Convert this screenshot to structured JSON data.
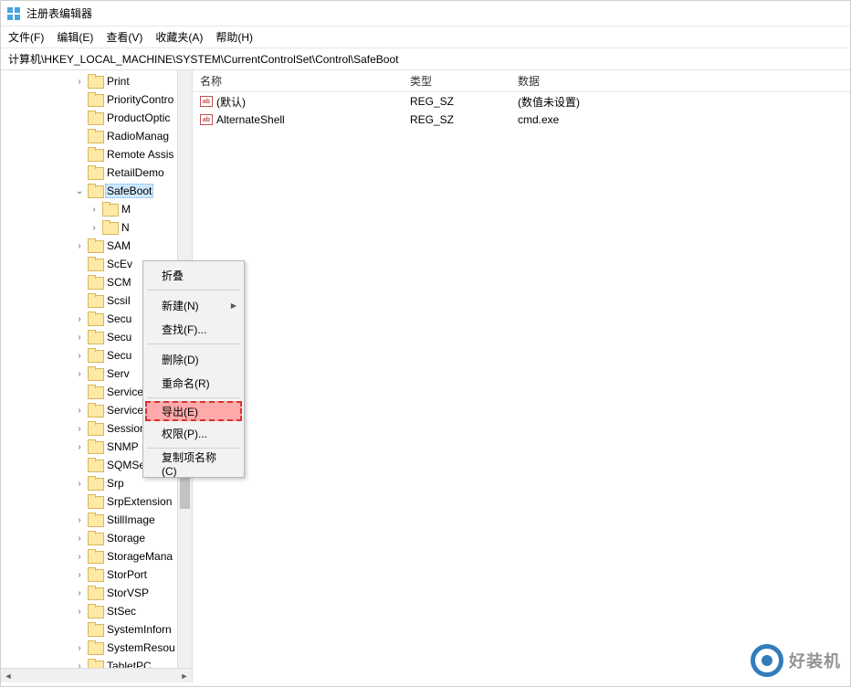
{
  "window": {
    "title": "注册表编辑器"
  },
  "menubar": [
    "文件(F)",
    "编辑(E)",
    "查看(V)",
    "收藏夹(A)",
    "帮助(H)"
  ],
  "address": "计算机\\HKEY_LOCAL_MACHINE\\SYSTEM\\CurrentControlSet\\Control\\SafeBoot",
  "tree": [
    {
      "indent": 5,
      "exp": ">",
      "label": "Print"
    },
    {
      "indent": 5,
      "exp": "",
      "label": "PriorityContro"
    },
    {
      "indent": 5,
      "exp": "",
      "label": "ProductOptic"
    },
    {
      "indent": 5,
      "exp": "",
      "label": "RadioManag"
    },
    {
      "indent": 5,
      "exp": "",
      "label": "Remote Assis"
    },
    {
      "indent": 5,
      "exp": "",
      "label": "RetailDemo"
    },
    {
      "indent": 5,
      "exp": "v",
      "label": "SafeBoot",
      "selected": true
    },
    {
      "indent": 6,
      "exp": ">",
      "label": "M"
    },
    {
      "indent": 6,
      "exp": ">",
      "label": "N"
    },
    {
      "indent": 5,
      "exp": ">",
      "label": "SAM"
    },
    {
      "indent": 5,
      "exp": "",
      "label": "ScEv"
    },
    {
      "indent": 5,
      "exp": "",
      "label": "SCM"
    },
    {
      "indent": 5,
      "exp": "",
      "label": "ScsiI"
    },
    {
      "indent": 5,
      "exp": ">",
      "label": "Secu"
    },
    {
      "indent": 5,
      "exp": ">",
      "label": "Secu"
    },
    {
      "indent": 5,
      "exp": ">",
      "label": "Secu"
    },
    {
      "indent": 5,
      "exp": ">",
      "label": "Serv"
    },
    {
      "indent": 5,
      "exp": "",
      "label": "ServiceGroup"
    },
    {
      "indent": 5,
      "exp": ">",
      "label": "ServiceProvic"
    },
    {
      "indent": 5,
      "exp": ">",
      "label": "Session Man"
    },
    {
      "indent": 5,
      "exp": ">",
      "label": "SNMP"
    },
    {
      "indent": 5,
      "exp": "",
      "label": "SQMServiceL"
    },
    {
      "indent": 5,
      "exp": ">",
      "label": "Srp"
    },
    {
      "indent": 5,
      "exp": "",
      "label": "SrpExtension"
    },
    {
      "indent": 5,
      "exp": ">",
      "label": "StillImage"
    },
    {
      "indent": 5,
      "exp": ">",
      "label": "Storage"
    },
    {
      "indent": 5,
      "exp": ">",
      "label": "StorageMana"
    },
    {
      "indent": 5,
      "exp": ">",
      "label": "StorPort"
    },
    {
      "indent": 5,
      "exp": ">",
      "label": "StorVSP"
    },
    {
      "indent": 5,
      "exp": ">",
      "label": "StSec"
    },
    {
      "indent": 5,
      "exp": "",
      "label": "SystemInforn"
    },
    {
      "indent": 5,
      "exp": ">",
      "label": "SystemResou"
    },
    {
      "indent": 5,
      "exp": ">",
      "label": "TabletPC"
    }
  ],
  "columns": {
    "name": "名称",
    "type": "类型",
    "data": "数据"
  },
  "values": [
    {
      "name": "(默认)",
      "type": "REG_SZ",
      "data": "(数值未设置)"
    },
    {
      "name": "AlternateShell",
      "type": "REG_SZ",
      "data": "cmd.exe"
    }
  ],
  "ctxmenu": {
    "collapse": "折叠",
    "new": "新建(N)",
    "find": "查找(F)...",
    "delete": "删除(D)",
    "rename": "重命名(R)",
    "export": "导出(E)",
    "permissions": "权限(P)...",
    "copykey": "复制项名称(C)"
  },
  "watermark": "好装机"
}
